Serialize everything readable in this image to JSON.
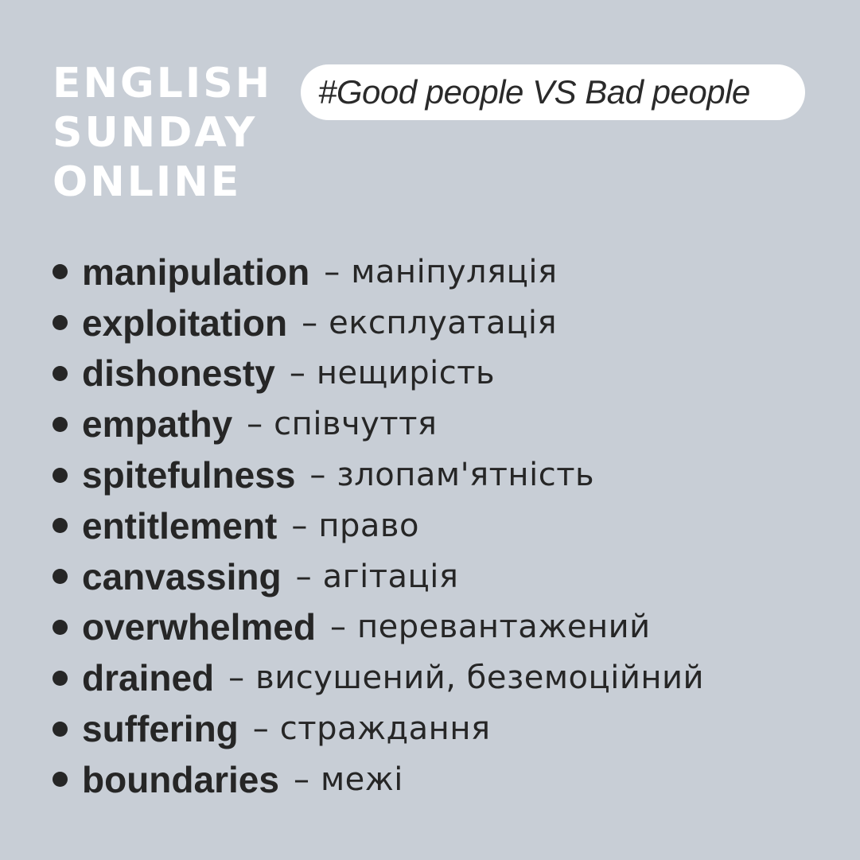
{
  "brand": {
    "line1": "ENGLISH",
    "line2": "SUNDAY",
    "line3": "ONLINE"
  },
  "hashtag": "#Good people VS Bad people",
  "vocabulary": [
    {
      "term": "manipulation",
      "dash": "–",
      "translation": "маніпуляція"
    },
    {
      "term": "exploitation",
      "dash": "–",
      "translation": "експлуатація"
    },
    {
      "term": "dishonesty",
      "dash": "–",
      "translation": "нещирість"
    },
    {
      "term": "empathy",
      "dash": "–",
      "translation": "співчуття"
    },
    {
      "term": "spitefulness",
      "dash": "–",
      "translation": "злопам'ятність"
    },
    {
      "term": "entitlement",
      "dash": "–",
      "translation": "право"
    },
    {
      "term": "canvassing",
      "dash": "–",
      "translation": "агітація"
    },
    {
      "term": "overwhelmed",
      "dash": "–",
      "translation": "перевантажений"
    },
    {
      "term": "drained",
      "dash": "–",
      "translation": "висушений, беземоційний"
    },
    {
      "term": "suffering",
      "dash": "–",
      "translation": "страждання"
    },
    {
      "term": "boundaries",
      "dash": "–",
      "translation": "межі"
    }
  ],
  "colors": {
    "background": "#c8ced6",
    "brand_text": "#ffffff",
    "pill_background": "#ffffff",
    "body_text": "#262626"
  }
}
